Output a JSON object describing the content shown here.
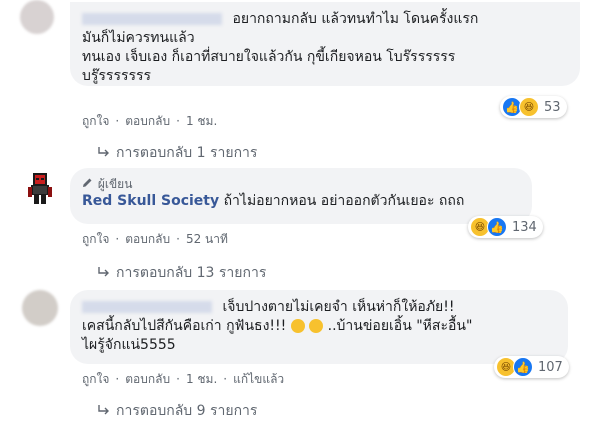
{
  "comment1": {
    "line1": "อยากถามกลับ แล้วทนทำไม โดนครั้งแรก",
    "line2": "มันก็ไม่ควรทนแล้ว",
    "line3": "ทนเอง เจ็บเอง ก็เอาที่สบายใจแล้วกัน กุขี้เกียจหอน โบร๊รรรรรร",
    "line4": "บรู๊รรรรรรร",
    "reaction_count": "53",
    "like_label": "ถูกใจ",
    "reply_label": "ตอบกลับ",
    "time": "1 ชม.",
    "replies": "การตอบกลับ 1 รายการ"
  },
  "comment2": {
    "badge": "ผู้เขียน",
    "author": "Red Skull Society",
    "text": "ถ้าไม่อยากหอน อย่าออกตัวกันเยอะ ถถถ",
    "reaction_count": "134",
    "like_label": "ถูกใจ",
    "reply_label": "ตอบกลับ",
    "time": "52 นาที",
    "replies": "การตอบกลับ 13 รายการ"
  },
  "comment3": {
    "line1": "เจ็บปางตายไม่เคยจำ เห็นห่าก็ให้อภัย!!",
    "line2": "เคสนี้กลับไปสีกันคือเก่า กูฟันธง!!!",
    "line2b": "..บ้านข่อยเอิ้น \"หีสะอื้น\"",
    "line3": "ไผรู้จักแน่5555",
    "reaction_count": "107",
    "like_label": "ถูกใจ",
    "reply_label": "ตอบกลับ",
    "time": "1 ชม.",
    "edited": "แก้ไขแล้ว",
    "replies": "การตอบกลับ 9 รายการ"
  },
  "colors": {
    "link": "#385898",
    "bubble": "#f2f3f5",
    "meta": "#606770",
    "like": "#1877f2",
    "haha": "#f7c12e"
  }
}
